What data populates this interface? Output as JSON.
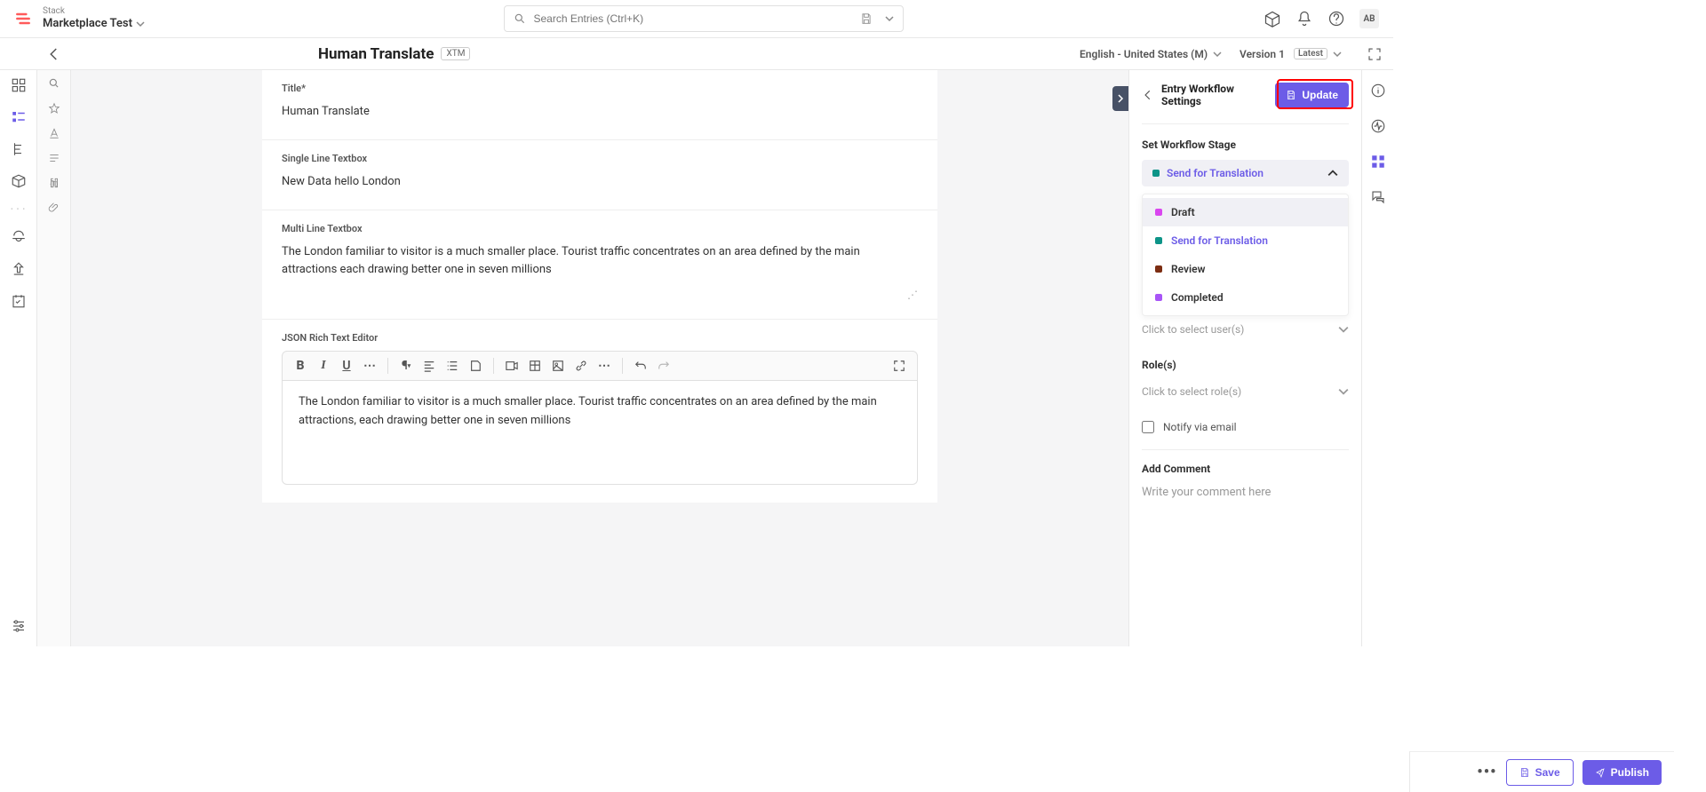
{
  "header": {
    "stack_label": "Stack",
    "stack_name": "Marketplace Test",
    "search_placeholder": "Search Entries (Ctrl+K)",
    "avatar": "AB"
  },
  "entry": {
    "title": "Human Translate",
    "badge": "XTM",
    "locale": "English - United States (M)",
    "version_label": "Version 1",
    "version_badge": "Latest"
  },
  "fields": {
    "title_label": "Title*",
    "title_value": "Human Translate",
    "single_label": "Single Line Textbox",
    "single_value": "New Data hello London",
    "multi_label": "Multi Line Textbox",
    "multi_value": "The London familiar to visitor is a much smaller place. Tourist traffic concentrates on an area defined by the main attractions each drawing better one in seven millions",
    "rte_label": "JSON Rich Text Editor",
    "rte_value": "The London familiar to visitor is a much smaller place. Tourist traffic concentrates on an area defined by the main attractions, each drawing better one in seven millions"
  },
  "panel": {
    "title": "Entry Workflow Settings",
    "update_label": "Update",
    "stage_label": "Set Workflow Stage",
    "stage_selected": "Send for Translation",
    "stages": [
      {
        "label": "Draft",
        "color": "#d946ef"
      },
      {
        "label": "Send for Translation",
        "color": "#0d9488"
      },
      {
        "label": "Review",
        "color": "#7c2d12"
      },
      {
        "label": "Completed",
        "color": "#a855f7"
      }
    ],
    "users_placeholder": "Click to select user(s)",
    "roles_label": "Role(s)",
    "roles_placeholder": "Click to select role(s)",
    "notify_label": "Notify via email",
    "comment_label": "Add Comment",
    "comment_placeholder": "Write your comment here"
  },
  "footer": {
    "save_label": "Save",
    "publish_label": "Publish"
  },
  "colors": {
    "accent": "#6c5ce7",
    "teal": "#0d9488"
  }
}
